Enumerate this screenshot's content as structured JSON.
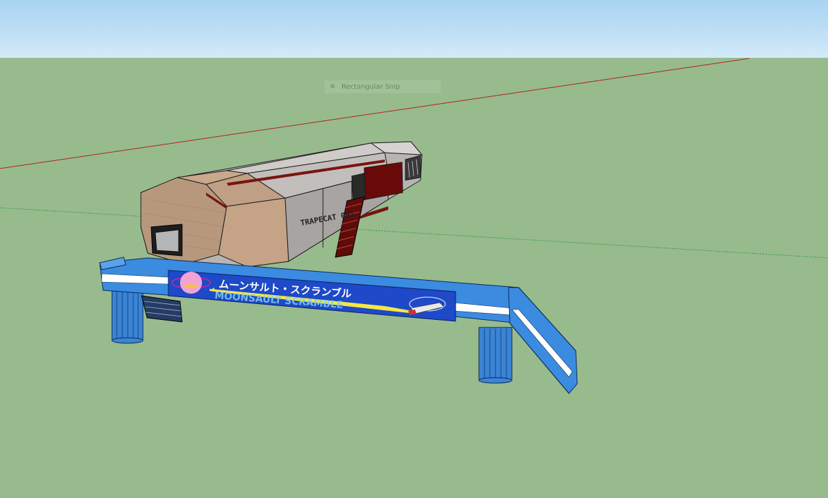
{
  "toast": {
    "label": "Rectangular Snip",
    "icon": "snip-icon"
  },
  "model": {
    "vehicle_label": "TRAPECAT 001",
    "sign_jp": "ムーンサルト・スクランブル",
    "sign_en": "MOONSAULT SCRAMBLE"
  },
  "colors": {
    "sky": "#c0e0f6",
    "ground": "#98bb8e",
    "red_axis": "#b1201a",
    "green_axis": "#2d9a38",
    "sign_blue": "#1e49c8",
    "track_blue": "#3b8be0"
  }
}
